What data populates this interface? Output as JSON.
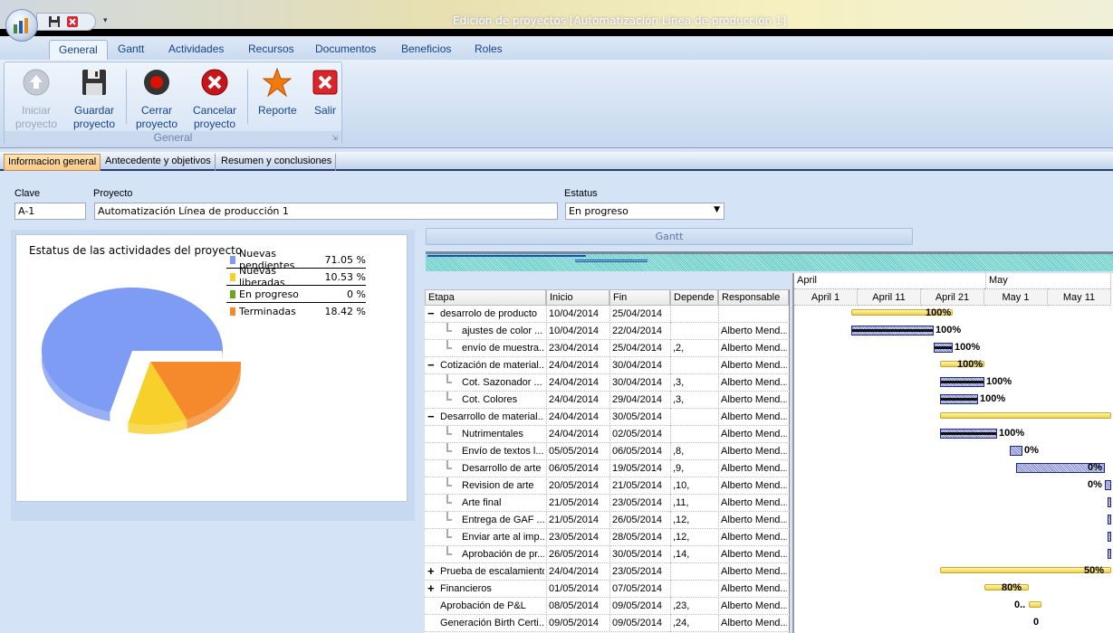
{
  "window": {
    "title": "Edición de proyectos [Automatización Línea de producción 1]"
  },
  "ribbon": {
    "tabs": [
      "General",
      "Gantt",
      "Actividades",
      "Recursos",
      "Documentos",
      "Beneficios",
      "Roles"
    ],
    "active_tab": "General",
    "buttons": [
      {
        "l1": "Iniciar",
        "l2": "proyecto",
        "icon": "arrow-up-icon",
        "disabled": true
      },
      {
        "l1": "Guardar",
        "l2": "proyecto",
        "icon": "save-icon",
        "disabled": false
      },
      {
        "l1": "Cerrar",
        "l2": "proyecto",
        "icon": "record-stop-icon",
        "disabled": false
      },
      {
        "l1": "Cancelar",
        "l2": "proyecto",
        "icon": "cancel-icon",
        "disabled": false
      },
      {
        "l1": "Reporte",
        "l2": "",
        "icon": "star-icon",
        "disabled": false
      },
      {
        "l1": "Salir",
        "l2": "",
        "icon": "exit-icon",
        "disabled": false
      }
    ],
    "group_label": "General"
  },
  "subtabs": [
    "Informacion general",
    "Antecedente y objetivos",
    "Resumen y conclusiones"
  ],
  "form": {
    "clave_label": "Clave",
    "clave_value": "A-1",
    "proyecto_label": "Proyecto",
    "proyecto_value": "Automatización Línea de producción 1",
    "estatus_label": "Estatus",
    "estatus_value": "En progreso"
  },
  "chart_data": {
    "type": "pie",
    "title": "Estatus de las actividades del proyecto",
    "legend_position": "top-right",
    "categories": [
      "Nuevas pendientes",
      "Nuevas liberadas",
      "En progreso",
      "Terminadas"
    ],
    "values": [
      71.05,
      10.53,
      0,
      18.42
    ],
    "labels": [
      "71.05 %",
      "10.53 %",
      "0 %",
      "18.42 %"
    ],
    "colors": [
      "#7f9cf5",
      "#f7d02c",
      "#6aa520",
      "#f58a2c"
    ]
  },
  "gantt": {
    "header": "Gantt",
    "columns": [
      "Etapa",
      "Inicio",
      "Fin",
      "Depende",
      "Responsable"
    ],
    "months": [
      "April",
      "May"
    ],
    "day_ticks": [
      "April 1",
      "April 11",
      "April 21",
      "May 1",
      "May 11"
    ],
    "rows": [
      {
        "etapa": "desarrolo de producto",
        "inicio": "10/04/2014",
        "fin": "25/04/2014",
        "depende": "",
        "resp": "",
        "level": 0,
        "expander": "minus",
        "type": "summary",
        "pct": "100%"
      },
      {
        "etapa": "ajustes de color ...",
        "inicio": "10/04/2014",
        "fin": "22/04/2014",
        "depende": "",
        "resp": "Alberto Mend...",
        "level": 1,
        "type": "task",
        "pct": "100%",
        "progress": 100
      },
      {
        "etapa": "envío de muestra...",
        "inicio": "23/04/2014",
        "fin": "25/04/2014",
        "depende": ",2,",
        "resp": "Alberto Mend...",
        "level": 1,
        "type": "task",
        "pct": "100%",
        "progress": 100
      },
      {
        "etapa": "Cotización de material...",
        "inicio": "24/04/2014",
        "fin": "30/04/2014",
        "depende": "",
        "resp": "Alberto Mend...",
        "level": 0,
        "expander": "minus",
        "type": "summary",
        "pct": "100%"
      },
      {
        "etapa": "Cot. Sazonador ...",
        "inicio": "24/04/2014",
        "fin": "30/04/2014",
        "depende": ",3,",
        "resp": "Alberto Mend...",
        "level": 1,
        "type": "task",
        "pct": "100%",
        "progress": 100
      },
      {
        "etapa": "Cot. Colores",
        "inicio": "24/04/2014",
        "fin": "29/04/2014",
        "depende": ",3,",
        "resp": "Alberto Mend...",
        "level": 1,
        "type": "task",
        "pct": "100%",
        "progress": 100
      },
      {
        "etapa": "Desarrollo de material...",
        "inicio": "24/04/2014",
        "fin": "30/05/2014",
        "depende": "",
        "resp": "Alberto Mend...",
        "level": 0,
        "expander": "minus",
        "type": "summary",
        "pct": ""
      },
      {
        "etapa": "Nutrimentales",
        "inicio": "24/04/2014",
        "fin": "02/05/2014",
        "depende": "",
        "resp": "Alberto Mend...",
        "level": 1,
        "type": "task",
        "pct": "100%",
        "progress": 100
      },
      {
        "etapa": "Envío de textos l...",
        "inicio": "05/05/2014",
        "fin": "06/05/2014",
        "depende": ",8,",
        "resp": "Alberto Mend...",
        "level": 1,
        "type": "task",
        "pct": "0%",
        "progress": 0
      },
      {
        "etapa": "Desarrollo de arte",
        "inicio": "06/05/2014",
        "fin": "19/05/2014",
        "depende": ",9,",
        "resp": "Alberto Mend...",
        "level": 1,
        "type": "task",
        "pct": "0%",
        "progress": 0
      },
      {
        "etapa": "Revision de arte",
        "inicio": "20/05/2014",
        "fin": "21/05/2014",
        "depende": ",10,",
        "resp": "Alberto Mend...",
        "level": 1,
        "type": "task",
        "pct": "0%",
        "progress": 0
      },
      {
        "etapa": "Arte final",
        "inicio": "21/05/2014",
        "fin": "23/05/2014",
        "depende": ",11,",
        "resp": "Alberto Mend...",
        "level": 1,
        "type": "task",
        "pct": "",
        "progress": 0
      },
      {
        "etapa": "Entrega de GAF ...",
        "inicio": "21/05/2014",
        "fin": "26/05/2014",
        "depende": ",12,",
        "resp": "Alberto Mend...",
        "level": 1,
        "type": "task",
        "pct": "",
        "progress": 0
      },
      {
        "etapa": "Enviar arte al imp...",
        "inicio": "23/05/2014",
        "fin": "28/05/2014",
        "depende": ",12,",
        "resp": "Alberto Mend...",
        "level": 1,
        "type": "task",
        "pct": "",
        "progress": 0
      },
      {
        "etapa": "Aprobación de pr...",
        "inicio": "26/05/2014",
        "fin": "30/05/2014",
        "depende": ",14,",
        "resp": "Alberto Mend...",
        "level": 1,
        "type": "task",
        "pct": "",
        "progress": 0
      },
      {
        "etapa": "Prueba de escalamiento",
        "inicio": "24/04/2014",
        "fin": "23/05/2014",
        "depende": "",
        "resp": "Alberto Mend...",
        "level": 0,
        "expander": "plus",
        "type": "summary",
        "pct": "50%"
      },
      {
        "etapa": "Financieros",
        "inicio": "01/05/2014",
        "fin": "07/05/2014",
        "depende": "",
        "resp": "Alberto Mend...",
        "level": 0,
        "expander": "plus",
        "type": "summary",
        "pct": "80%"
      },
      {
        "etapa": "Aprobación de P&L",
        "inicio": "08/05/2014",
        "fin": "09/05/2014",
        "depende": ",23,",
        "resp": "Alberto Mend...",
        "level": 0,
        "type": "summary",
        "pct": "0.."
      },
      {
        "etapa": "Generación Birth Certi...",
        "inicio": "09/05/2014",
        "fin": "09/05/2014",
        "depende": ",24,",
        "resp": "Alberto Mend...",
        "level": 0,
        "type": "milestone",
        "pct": "0"
      }
    ]
  }
}
